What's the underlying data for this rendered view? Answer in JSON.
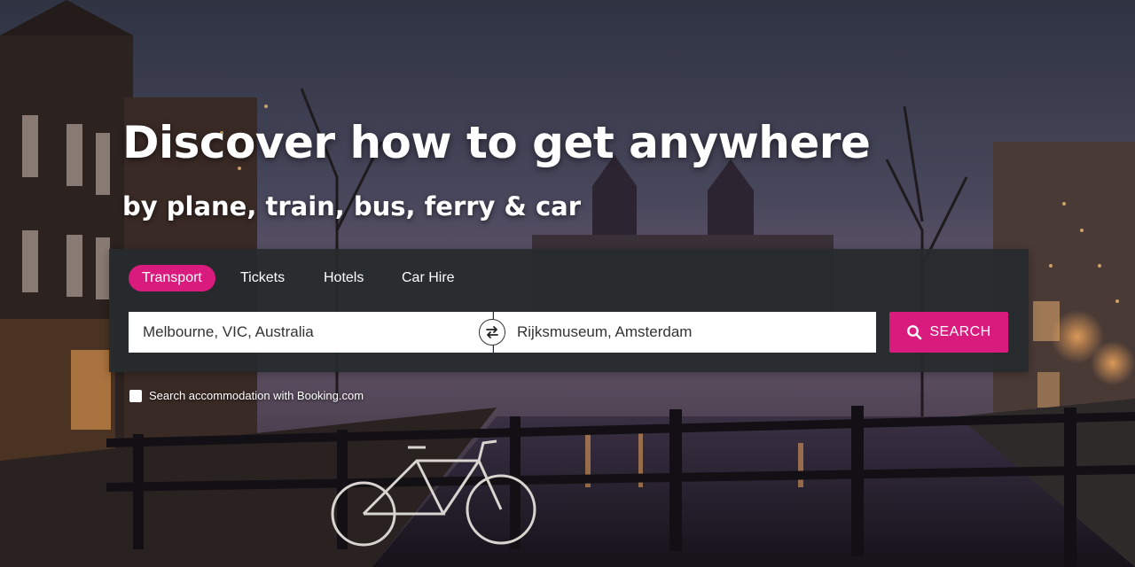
{
  "hero": {
    "headline": "Discover how to get anywhere",
    "subline": "by plane, train, bus, ferry & car"
  },
  "tabs": [
    {
      "label": "Transport",
      "active": true
    },
    {
      "label": "Tickets",
      "active": false
    },
    {
      "label": "Hotels",
      "active": false
    },
    {
      "label": "Car Hire",
      "active": false
    }
  ],
  "search": {
    "origin_value": "Melbourne, VIC, Australia",
    "destination_value": "Rijksmuseum, Amsterdam",
    "swap_icon": "swap-arrows-icon",
    "button_icon": "search-icon",
    "button_label": "SEARCH"
  },
  "accommodation": {
    "label": "Search accommodation with Booking.com",
    "checked": false
  },
  "colors": {
    "accent": "#d91b7e",
    "panel": "#262a2d",
    "text_light": "#ffffff"
  }
}
